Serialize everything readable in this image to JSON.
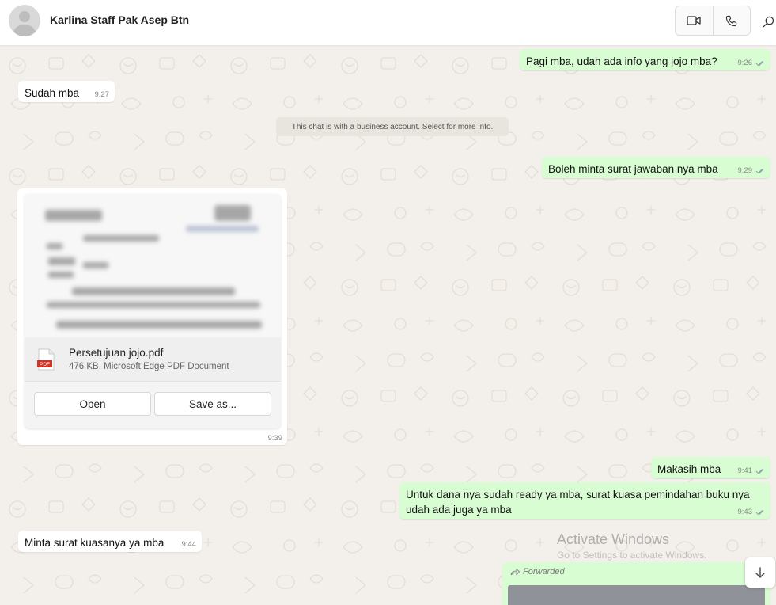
{
  "contact": {
    "name": "Karlina Staff Pak Asep Btn"
  },
  "header_icons": {
    "video": "video-camera-icon",
    "voice": "phone-icon",
    "search": "search-icon"
  },
  "system_message": "This chat is with a business account. Select for more info.",
  "messages": [
    {
      "dir": "out",
      "text": "Pagi mba, udah ada info yang jojo mba?",
      "time": "9:26",
      "read": true
    },
    {
      "dir": "in",
      "text": "Sudah mba",
      "time": "9:27"
    },
    {
      "dir": "out",
      "text": "Boleh minta surat jawaban nya mba",
      "time": "9:29",
      "read": true
    },
    {
      "dir": "in",
      "type": "document",
      "time": "9:39",
      "document": {
        "name": "Persetujuan jojo.pdf",
        "info": "476 KB, Microsoft Edge PDF Document",
        "icon_label": "PDF",
        "open_label": "Open",
        "save_label": "Save as..."
      }
    },
    {
      "dir": "out",
      "text": "Makasih mba",
      "time": "9:41",
      "read": true
    },
    {
      "dir": "out",
      "text": "Untuk dana nya sudah ready ya mba, surat kuasa pemindahan buku nya\nudah ada juga ya mba",
      "time": "9:43",
      "read": true
    },
    {
      "dir": "in",
      "text": "Minta surat kuasanya ya mba",
      "time": "9:44"
    },
    {
      "dir": "out",
      "type": "forwarded",
      "label": "Forwarded"
    }
  ],
  "overlay": {
    "title": "Activate Windows",
    "subtitle": "Go to Settings to activate Windows."
  },
  "colors": {
    "outgoing_bubble": "#d9fdd3",
    "incoming_bubble": "#ffffff",
    "background": "#efeae2",
    "read_tick": "#53bdeb",
    "pdf_red": "#d93025"
  }
}
